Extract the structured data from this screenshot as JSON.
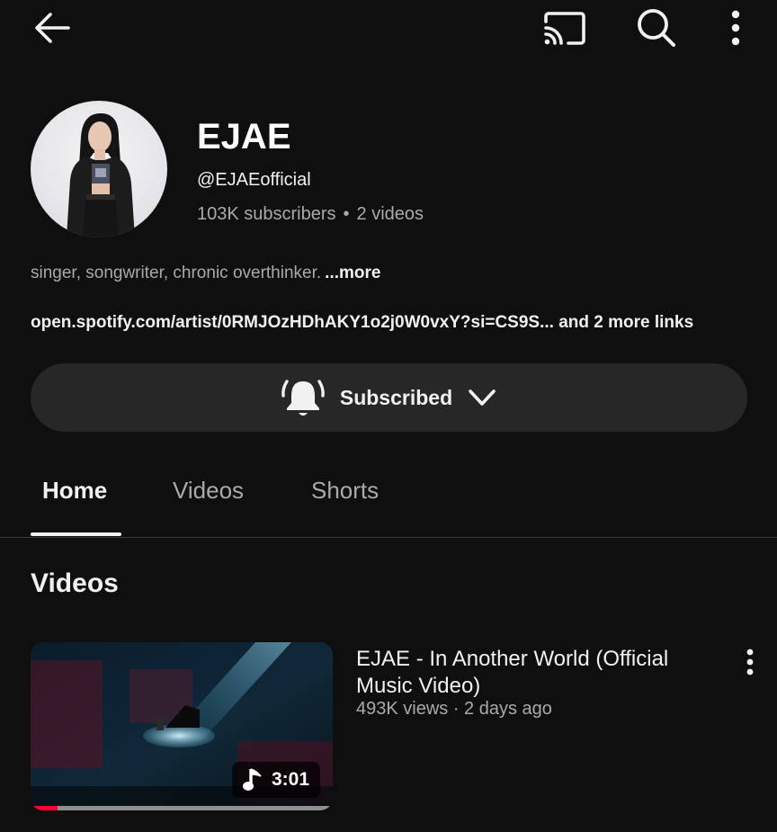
{
  "topbar": {
    "back_icon": "arrow-left-icon",
    "cast_icon": "cast-icon",
    "search_icon": "search-icon",
    "more_icon": "more-vertical-icon"
  },
  "channel": {
    "name": "EJAE",
    "handle": "@EJAEofficial",
    "subscribers": "103K subscribers",
    "separator": "•",
    "video_count": "2 videos",
    "description": "singer, songwriter, chronic overthinker.",
    "more_label": "...more",
    "links": "open.spotify.com/artist/0RMJOzHDhAKY1o2j0W0vxY?si=CS9S... and 2 more links"
  },
  "subscribe": {
    "bell_icon": "bell-ringing-icon",
    "label": "Subscribed",
    "chevron_icon": "chevron-down-icon"
  },
  "tabs": [
    {
      "label": "Home",
      "active": true
    },
    {
      "label": "Videos",
      "active": false
    },
    {
      "label": "Shorts",
      "active": false
    }
  ],
  "section": {
    "title": "Videos"
  },
  "videos": [
    {
      "title": "EJAE  - In Another World (Official Music Video)",
      "meta": "493K views · 2 days ago",
      "duration": "3:01",
      "duration_icon": "music-note-icon",
      "watch_progress": 0.09,
      "more_icon": "more-vertical-icon"
    }
  ],
  "colors": {
    "background": "#0f0f0f",
    "text_primary": "#f1f1f1",
    "text_secondary": "#aaaaaa",
    "button_bg": "#272727",
    "progress_red": "#ff0033"
  }
}
